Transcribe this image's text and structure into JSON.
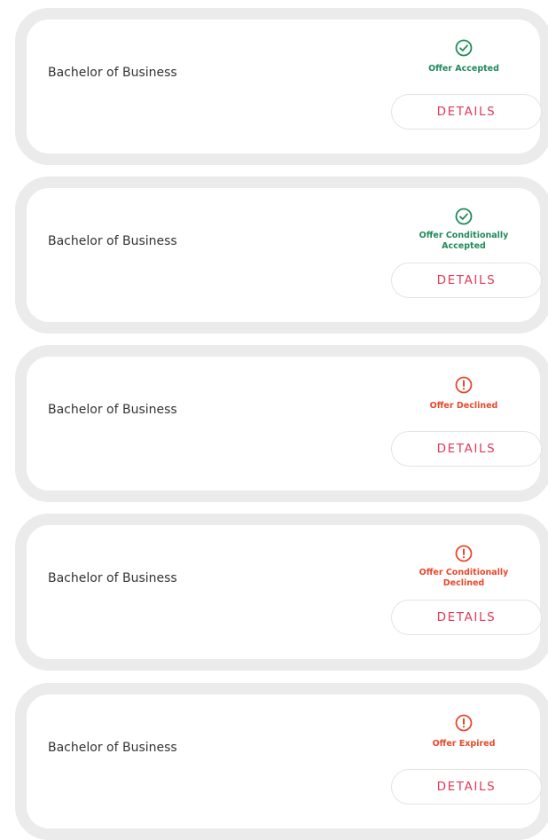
{
  "colors": {
    "accepted": "#1f8a5b",
    "declined": "#e8482c",
    "details_text": "#e03a5a",
    "card_border": "#ebebeb"
  },
  "offers": [
    {
      "course": "Bachelor of Business",
      "status": "Offer Accepted",
      "status_icon": "check-circle-icon",
      "details_label": "DETAILS"
    },
    {
      "course": "Bachelor of Business",
      "status": "Offer Conditionally Accepted",
      "status_icon": "check-circle-icon",
      "details_label": "DETAILS"
    },
    {
      "course": "Bachelor of Business",
      "status": "Offer Declined",
      "status_icon": "alert-circle-icon",
      "details_label": "DETAILS"
    },
    {
      "course": "Bachelor of Business",
      "status": "Offer Conditionally Declined",
      "status_icon": "alert-circle-icon",
      "details_label": "DETAILS"
    },
    {
      "course": "Bachelor of Business",
      "status": "Offer Expired",
      "status_icon": "alert-circle-icon",
      "details_label": "DETAILS"
    }
  ]
}
